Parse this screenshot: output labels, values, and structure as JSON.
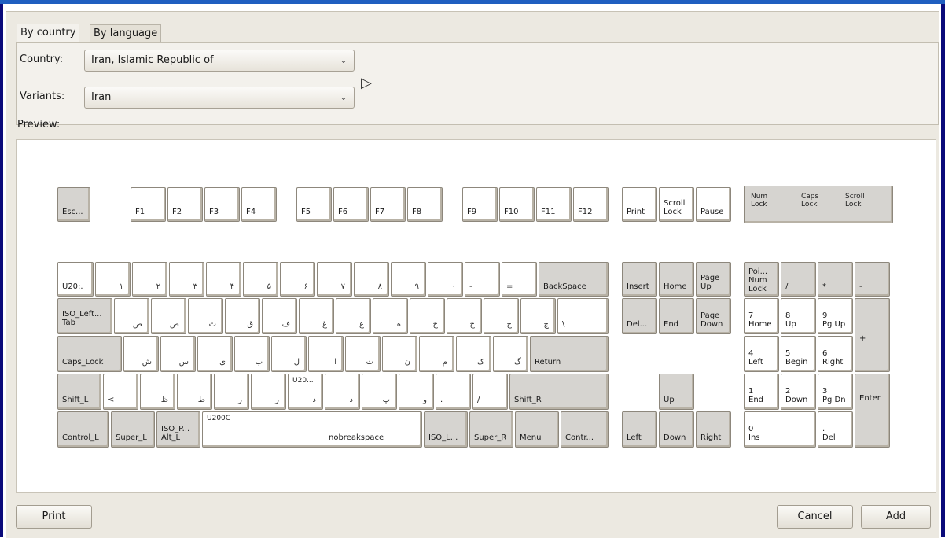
{
  "tabs": [
    {
      "label": "By country"
    },
    {
      "label": "By language"
    }
  ],
  "form": {
    "country_label": "Country:",
    "country_value": "Iran, Islamic Republic of",
    "variants_label": "Variants:",
    "variants_value": "Iran"
  },
  "preview_label": "Preview:",
  "buttons": {
    "print": "Print",
    "cancel": "Cancel",
    "add": "Add"
  },
  "keyboard": {
    "function_row": [
      "Esc...",
      "F1",
      "F2",
      "F3",
      "F4",
      "F5",
      "F6",
      "F7",
      "F8",
      "F9",
      "F10",
      "F11",
      "F12",
      "Print",
      "Scroll\nLock",
      "Pause"
    ],
    "indicators": [
      "Num\nLock",
      "Caps\nLock",
      "Scroll\nLock"
    ],
    "row1": [
      "U20:.",
      "۱",
      "۲",
      "۳",
      "۴",
      "۵",
      "۶",
      "۷",
      "۸",
      "۹",
      "۰",
      "-",
      "=",
      "BackSpace"
    ],
    "row2": [
      "ISO_Left...\nTab",
      "ض",
      "ص",
      "ث",
      "ق",
      "ف",
      "غ",
      "ع",
      "ه",
      "خ",
      "ح",
      "ج",
      "چ",
      "\\"
    ],
    "row3": [
      "Caps_Lock",
      "ش",
      "س",
      "ی",
      "ب",
      "ل",
      "ا",
      "ت",
      "ن",
      "م",
      "ک",
      "گ",
      "Return"
    ],
    "row4": [
      "Shift_L",
      "<",
      "ظ",
      "ط",
      "ز",
      "ر",
      "ذ",
      "د",
      "پ",
      "و",
      ".",
      "/",
      "Shift_R"
    ],
    "row5": [
      "Control_L",
      "Super_L",
      "ISO_P...\nAlt_L",
      "U200C",
      "nobreakspace",
      "ISO_L...",
      "Super_R",
      "Menu",
      "Contr..."
    ],
    "nav": [
      "Insert",
      "Home",
      "Page\nUp",
      "Del...",
      "End",
      "Page\nDown",
      "Up",
      "Left",
      "Down",
      "Right"
    ],
    "numpad": [
      "Poi...\nNum\nLock",
      "/",
      "*",
      "-",
      "7\nHome",
      "8\nUp",
      "9\nPg Up",
      "+",
      "4\nLeft",
      "5\nBegin",
      "6\nRight",
      "1\nEnd",
      "2\nDown",
      "3\nPg Dn",
      "Enter",
      "0\nIns",
      ".\nDel"
    ]
  }
}
